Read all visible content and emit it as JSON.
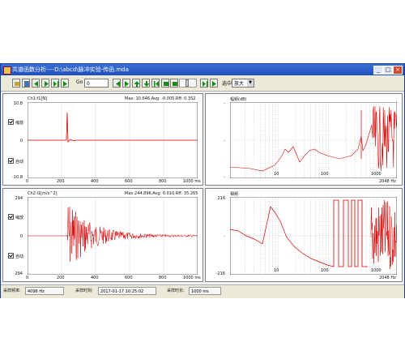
{
  "window": {
    "title": "共谱函数分析----D:\\abcd\\脉冲实验-传函.mda",
    "min_label": "_",
    "max_label": "□",
    "close_label": "×"
  },
  "toolbar": {
    "go_label": "Go",
    "go_value": "0",
    "select_label": "选中",
    "select_value": "放大",
    "icons": [
      "open-icon",
      "save-icon",
      "prev-frame-icon",
      "play-icon",
      "next-frame-icon",
      "step-forward-icon",
      "step-back-icon",
      "zoom-in-icon",
      "zoom-out-icon",
      "arrow-up-icon",
      "arrow-down-icon",
      "stop-icon",
      "record-icon",
      "pause-icon",
      "first-icon",
      "last-icon"
    ]
  },
  "panels": {
    "ch1": {
      "header_left": "Ch1:f1[N]",
      "header_right": "Max: 10.646,Avg: -0.005,Rff:  0.352",
      "y_top": "10.8",
      "y_mid": "0",
      "y_bottom": "-10.8",
      "x_ticks": [
        "0",
        "200",
        "400",
        "600",
        "800",
        "1000 ms"
      ],
      "check_top": "缩放",
      "check_bottom": "自动"
    },
    "ch2": {
      "header_left": "Ch2:l1[m/s^2]",
      "header_right": "Max:244.896,Avg:  0.010,Rff: 35.265",
      "y_top": "294",
      "y_mid": "0",
      "y_bottom": "-294",
      "x_ticks": [
        "0",
        "200",
        "400",
        "600",
        "800",
        "1000 ms"
      ],
      "check_top": "缩放",
      "check_bottom": "自动"
    },
    "mag": {
      "header_left": "幅频(dB)",
      "y_top": "-",
      "y_mid": "-",
      "y_bottom": "-",
      "x_ticks": [
        "10",
        "100",
        "1000",
        "2048 Hz"
      ]
    },
    "phase": {
      "header_left": "相频",
      "y_top": "216",
      "y_mid": "-",
      "y_bottom": "-216",
      "x_ticks": [
        "10",
        "100",
        "1000",
        "2048 Hz"
      ]
    }
  },
  "status": {
    "rate_label": "采样频率:",
    "rate_value": "4096  Hz",
    "time_label": "采样时刻:",
    "time_value": "2017-01-17    10:25:02",
    "len_label": "采样时长:",
    "len_value": "1000  ms"
  },
  "colors": {
    "trace": "#d40000",
    "title_bar": "#2457c5",
    "toolbar_bg": "#ece9d8"
  }
}
